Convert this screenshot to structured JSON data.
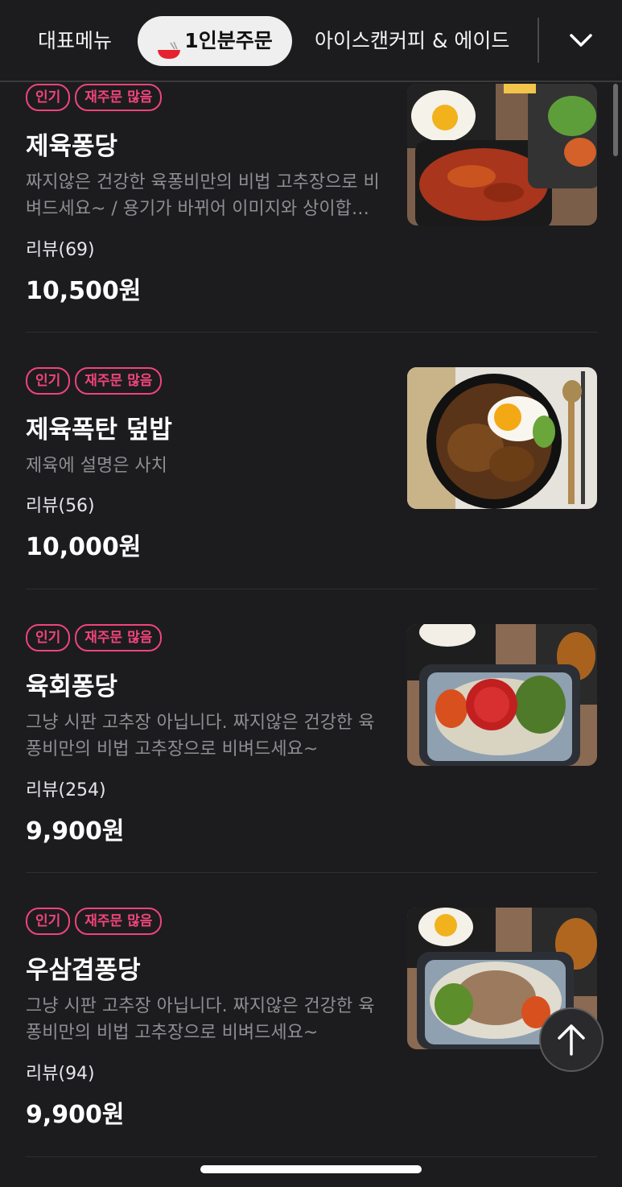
{
  "tabs": {
    "representative": "대표메뉴",
    "single_order": "1인분주문",
    "drinks": "아이스캔커피 & 에이드"
  },
  "badges": {
    "popular": "인기",
    "reorder": "재주문 많음"
  },
  "colors": {
    "background": "#1c1c1e",
    "badge_accent": "#f0447a",
    "active_tab_bg": "#efefef",
    "description_text": "#8e8e93"
  },
  "icons": {
    "bowl": "red-bowl-icon",
    "chevron": "chevron-down-icon",
    "to_top": "arrow-up-icon"
  },
  "menu": [
    {
      "name": "제육퐁당",
      "description": "짜지않은 건강한 육퐁비만의 비법 고추장으로 비벼드세요~ / 용기가 바뀌어 이미지와 상이합…",
      "review": "리뷰(69)",
      "price": "10,500원"
    },
    {
      "name": "제육폭탄 덮밥",
      "description": "제육에 설명은 사치",
      "review": "리뷰(56)",
      "price": "10,000원"
    },
    {
      "name": "육회퐁당",
      "description": "그냥 시판 고추장 아닙니다. 짜지않은 건강한 육퐁비만의 비법 고추장으로 비벼드세요~",
      "review": "리뷰(254)",
      "price": "9,900원"
    },
    {
      "name": "우삼겹퐁당",
      "description": "그냥 시판 고추장 아닙니다. 짜지않은 건강한 육퐁비만의 비법 고추장으로 비벼드세요~",
      "review": "리뷰(94)",
      "price": "9,900원"
    }
  ]
}
